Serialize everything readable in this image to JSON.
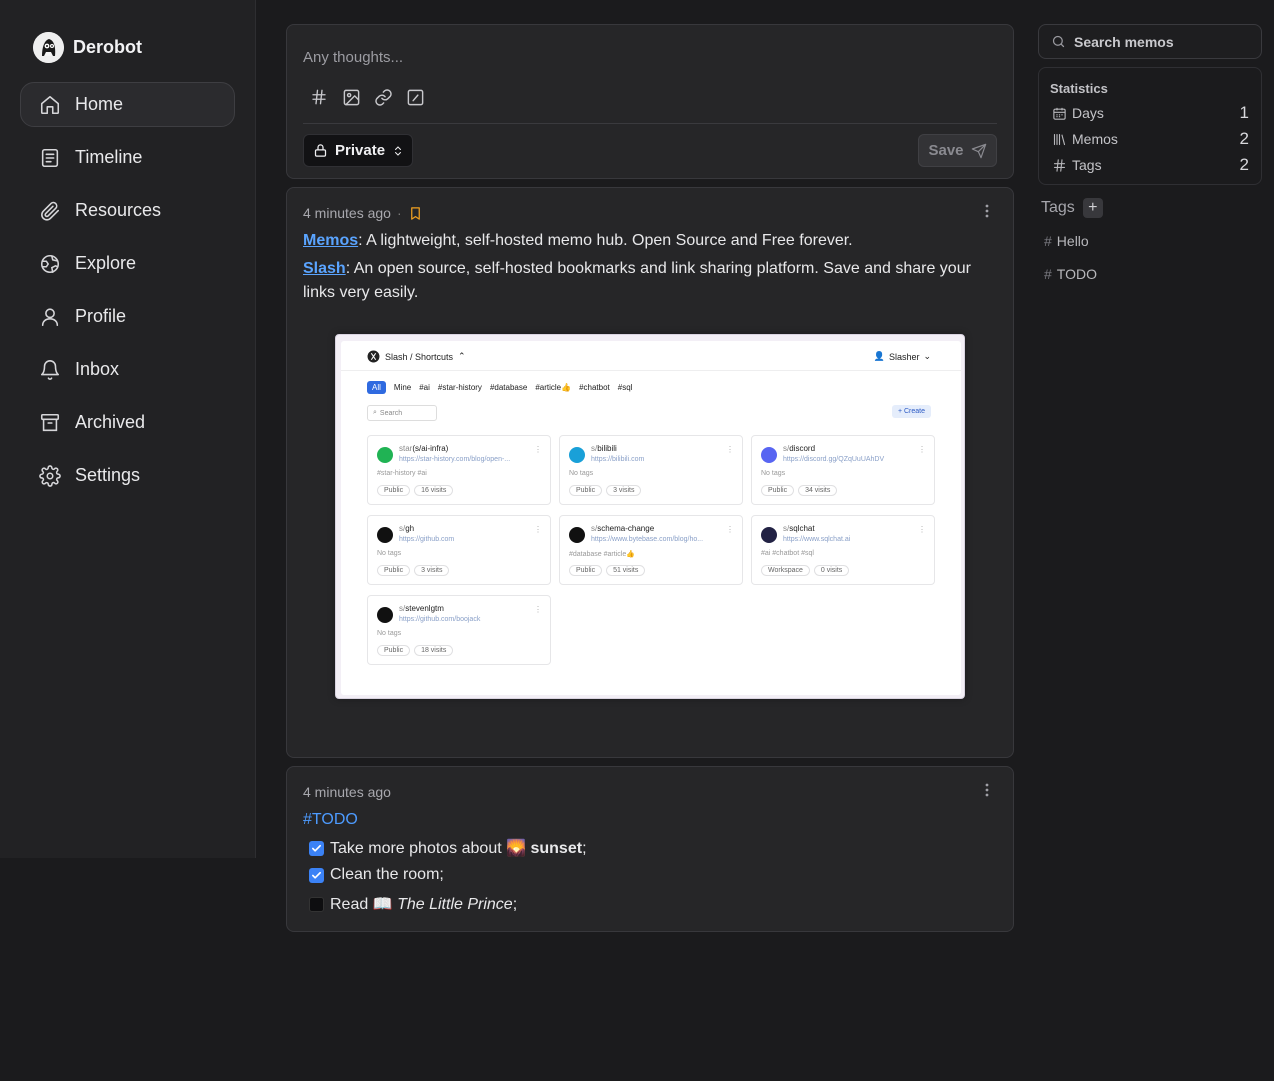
{
  "brand": {
    "name": "Derobot"
  },
  "nav": [
    {
      "label": "Home",
      "active": true,
      "icon": "home-icon"
    },
    {
      "label": "Timeline",
      "icon": "timeline-icon"
    },
    {
      "label": "Resources",
      "icon": "paperclip-icon"
    },
    {
      "label": "Explore",
      "icon": "globe-icon"
    },
    {
      "label": "Profile",
      "icon": "user-icon"
    },
    {
      "label": "Inbox",
      "icon": "bell-icon"
    },
    {
      "label": "Archived",
      "icon": "archive-icon"
    },
    {
      "label": "Settings",
      "icon": "gear-icon"
    }
  ],
  "editor": {
    "placeholder": "Any thoughts...",
    "visibility": "Private",
    "save_label": "Save"
  },
  "memos": [
    {
      "time": "4 minutes ago",
      "line1_link": "Memos",
      "line1_text": ": A lightweight, self-hosted memo hub. Open Source and Free forever.",
      "line2_link": "Slash",
      "line2_text": ": An open source, self-hosted bookmarks and link sharing platform. Save and share your links very easily."
    },
    {
      "time": "4 minutes ago",
      "tag": "#TODO",
      "tasks": [
        {
          "pre": "Take more photos about ",
          "emoji": "🌄",
          "strong": "sunset",
          "post": ";",
          "checked": true
        },
        {
          "pre": "Clean the room;",
          "checked": true
        },
        {
          "pre": "Read ",
          "emoji": "📖",
          "em": "The Little Prince",
          "post": ";",
          "checked": false
        }
      ]
    }
  ],
  "slash_shot": {
    "brand": "Slash / Shortcuts",
    "user": "Slasher",
    "tags": [
      "All",
      "Mine",
      "#ai",
      "#star-history",
      "#database",
      "#article👍",
      "#chatbot",
      "#sql"
    ],
    "search": "Search",
    "create": "+ Create",
    "cards": [
      {
        "name_pre": "star",
        "name": "(s/ai-infra)",
        "url": "https://star-history.com/blog/open-...",
        "tags": "#star-history  #ai",
        "vis": "Public",
        "visits": "16 visits",
        "color": "#20b354"
      },
      {
        "name_pre": "s/",
        "name": "bilibili",
        "url": "https://bilibili.com",
        "tags": "No tags",
        "vis": "Public",
        "visits": "3 visits",
        "color": "#19a0d8"
      },
      {
        "name_pre": "s/",
        "name": "discord",
        "url": "https://discord.gg/QZqUuUAhDV",
        "tags": "No tags",
        "vis": "Public",
        "visits": "34 visits",
        "color": "#5865f2"
      },
      {
        "name_pre": "s/",
        "name": "gh",
        "url": "https://github.com",
        "tags": "No tags",
        "vis": "Public",
        "visits": "3 visits",
        "color": "#111111"
      },
      {
        "name_pre": "s/",
        "name": "schema-change",
        "url": "https://www.bytebase.com/blog/ho...",
        "tags": "#database  #article👍",
        "vis": "Public",
        "visits": "51 visits",
        "color": "#111111"
      },
      {
        "name_pre": "s/",
        "name": "sqlchat",
        "url": "https://www.sqlchat.ai",
        "tags": "#ai  #chatbot  #sql",
        "vis": "Workspace",
        "visits": "0 visits",
        "color": "#222244"
      },
      {
        "name_pre": "s/",
        "name": "stevenlgtm",
        "url": "https://github.com/boojack",
        "tags": "No tags",
        "vis": "Public",
        "visits": "18 visits",
        "color": "#111111"
      }
    ]
  },
  "search": {
    "placeholder": "Search memos"
  },
  "stats": {
    "title": "Statistics",
    "rows": [
      {
        "label": "Days",
        "value": "1"
      },
      {
        "label": "Memos",
        "value": "2"
      },
      {
        "label": "Tags",
        "value": "2"
      }
    ]
  },
  "tags": {
    "title": "Tags",
    "items": [
      "Hello",
      "TODO"
    ]
  }
}
